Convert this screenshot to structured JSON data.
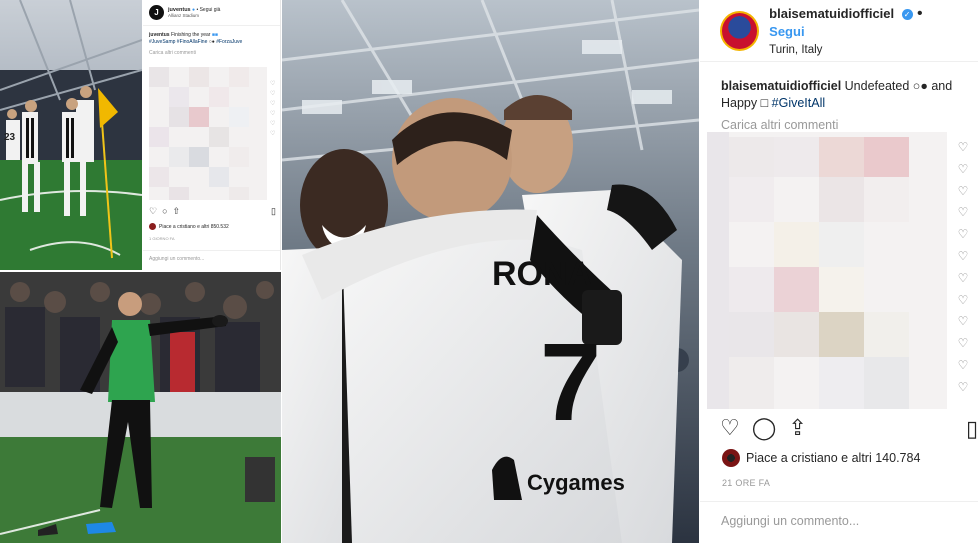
{
  "mini_post": {
    "username": "juventus",
    "verified_icon": "verified-badge-icon",
    "follow_label": "• Segui già",
    "location": "Allianz Stadium",
    "caption_user": "juventus",
    "caption_text": "Finishing the year",
    "caption_hashtags": "#JuveSamp #FinoAllaFine",
    "caption_hashtag2": "#ForzaJuve",
    "load_more": "Carica altri commenti",
    "likes_text": "Piace a cristiano e altri 850.532",
    "time": "1 GIORNO FA",
    "add_comment": "Aggiungi un commento..."
  },
  "side_post": {
    "username": "blaisematuidiofficiel",
    "verified_icon": "verified-badge-icon",
    "follow_sep": "•",
    "follow_label": "Segui",
    "location": "Turin, Italy",
    "caption_user": "blaisematuidiofficiel",
    "caption_text": "Undefeated ○● and Happy □",
    "caption_hashtag": "#GiveItAll",
    "load_more": "Carica altri commenti",
    "likes_text": "Piace a cristiano e altri 140.784",
    "time": "21 ORE FA",
    "add_comment": "Aggiungi un commento..."
  },
  "icons": {
    "heart": "heart-icon",
    "comment": "comment-icon",
    "share": "share-icon",
    "bookmark": "bookmark-icon"
  },
  "photo_texts": {
    "shirt_number": "7",
    "shirt_name": "RONA",
    "sponsor": "Cygames",
    "small_shirt_number": "23"
  }
}
